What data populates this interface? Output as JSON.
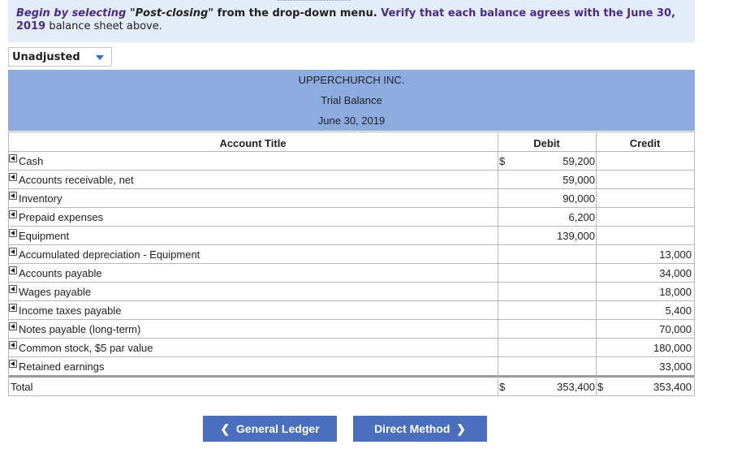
{
  "instruction": {
    "part1": "Begin by selecting ",
    "part2": "\"Post-closing\"",
    "part3": " from the drop-down menu.",
    "part4": "  Verify that each balance agrees with the June 30, ",
    "part5": "2019",
    "part6": " balance sheet above."
  },
  "dropdown": {
    "selected": "Unadjusted"
  },
  "header": {
    "company": "UPPERCHURCH INC.",
    "statement": "Trial Balance",
    "date": "June 30, 2019"
  },
  "columns": {
    "account": "Account Title",
    "debit": "Debit",
    "credit": "Credit"
  },
  "rows": [
    {
      "account": "Cash",
      "dollar": "$",
      "debit": "59,200",
      "credit": ""
    },
    {
      "account": "Accounts receivable, net",
      "dollar": "",
      "debit": "59,000",
      "credit": ""
    },
    {
      "account": "Inventory",
      "dollar": "",
      "debit": "90,000",
      "credit": ""
    },
    {
      "account": "Prepaid expenses",
      "dollar": "",
      "debit": "6,200",
      "credit": ""
    },
    {
      "account": "Equipment",
      "dollar": "",
      "debit": "139,000",
      "credit": ""
    },
    {
      "account": "Accumulated depreciation - Equipment",
      "dollar": "",
      "debit": "",
      "credit": "13,000"
    },
    {
      "account": "Accounts payable",
      "dollar": "",
      "debit": "",
      "credit": "34,000"
    },
    {
      "account": "Wages payable",
      "dollar": "",
      "debit": "",
      "credit": "18,000"
    },
    {
      "account": "Income taxes payable",
      "dollar": "",
      "debit": "",
      "credit": "5,400"
    },
    {
      "account": "Notes payable (long-term)",
      "dollar": "",
      "debit": "",
      "credit": "70,000"
    },
    {
      "account": "Common stock, $5 par value",
      "dollar": "",
      "debit": "",
      "credit": "180,000"
    },
    {
      "account": "Retained earnings",
      "dollar": "",
      "debit": "",
      "credit": "33,000"
    }
  ],
  "total": {
    "label": "Total",
    "dollar_debit": "$",
    "debit": "353,400",
    "dollar_credit": "$",
    "credit": "353,400"
  },
  "nav": {
    "prev": "General Ledger",
    "next": "Direct Method"
  }
}
